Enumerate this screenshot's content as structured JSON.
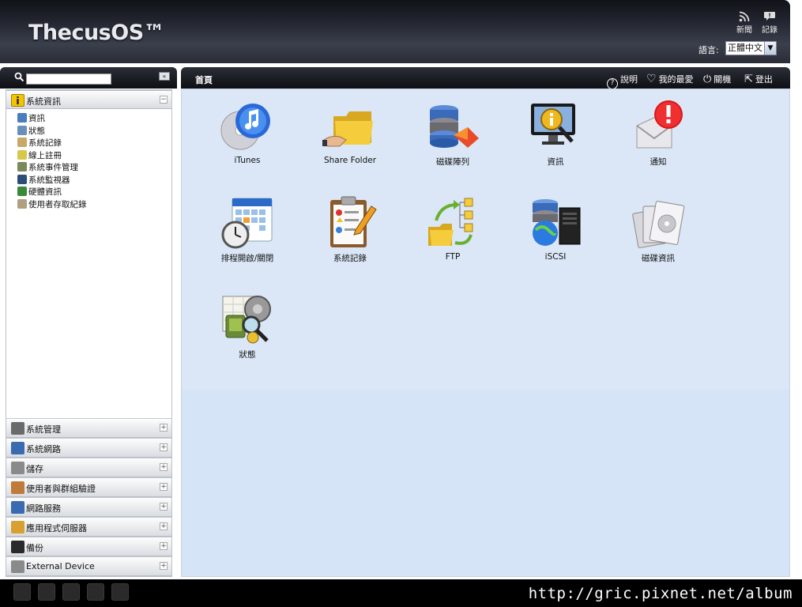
{
  "header": {
    "logo": "ThecusOS™",
    "news_label": "新聞",
    "log_label": "記錄",
    "language_label": "語言:",
    "language_value": "正體中文"
  },
  "sidebar": {
    "search_placeholder": "",
    "collapse_symbol": "«",
    "active_group": "系統資訊",
    "active_toggle": "−",
    "items": [
      {
        "label": "資訊",
        "color": "#4a7cc0"
      },
      {
        "label": "狀態",
        "color": "#6a8fb8"
      },
      {
        "label": "系統記錄",
        "color": "#c9a968"
      },
      {
        "label": "線上註冊",
        "color": "#d8c84a"
      },
      {
        "label": "系統事件管理",
        "color": "#7a8a5a"
      },
      {
        "label": "系統監視器",
        "color": "#2c4d7a"
      },
      {
        "label": "硬體資訊",
        "color": "#3a8a3a"
      },
      {
        "label": "使用者存取紀錄",
        "color": "#b0a080"
      }
    ],
    "groups": [
      {
        "label": "系統管理",
        "color": "#6a6a6a"
      },
      {
        "label": "系統網路",
        "color": "#3a6ab0"
      },
      {
        "label": "儲存",
        "color": "#8a8a8a"
      },
      {
        "label": "使用者與群組驗證",
        "color": "#c07a3a"
      },
      {
        "label": "網路服務",
        "color": "#3a6ab0"
      },
      {
        "label": "應用程式伺服器",
        "color": "#d8a030"
      },
      {
        "label": "備份",
        "color": "#2a2a2a"
      },
      {
        "label": "External Device",
        "color": "#8a8a8a"
      }
    ],
    "group_toggle": "+"
  },
  "main": {
    "title": "首頁",
    "actions": {
      "help": "說明",
      "favorites": "我的最愛",
      "shutdown": "關機",
      "logout": "登出"
    },
    "tiles": [
      {
        "label": "iTunes",
        "icon": "itunes-icon"
      },
      {
        "label": "Share Folder",
        "icon": "folder-icon"
      },
      {
        "label": "磁碟陣列",
        "icon": "raid-icon"
      },
      {
        "label": "資訊",
        "icon": "info-monitor-icon"
      },
      {
        "label": "通知",
        "icon": "notification-icon"
      },
      {
        "label": "排程開啟/關閉",
        "icon": "schedule-icon"
      },
      {
        "label": "系統記錄",
        "icon": "clipboard-log-icon"
      },
      {
        "label": "FTP",
        "icon": "ftp-icon"
      },
      {
        "label": "iSCSI",
        "icon": "iscsi-icon"
      },
      {
        "label": "磁碟資訊",
        "icon": "disk-info-icon"
      },
      {
        "label": "狀態",
        "icon": "status-icon"
      }
    ]
  },
  "footer": {
    "watermark": "http://gric.pixnet.net/album"
  }
}
